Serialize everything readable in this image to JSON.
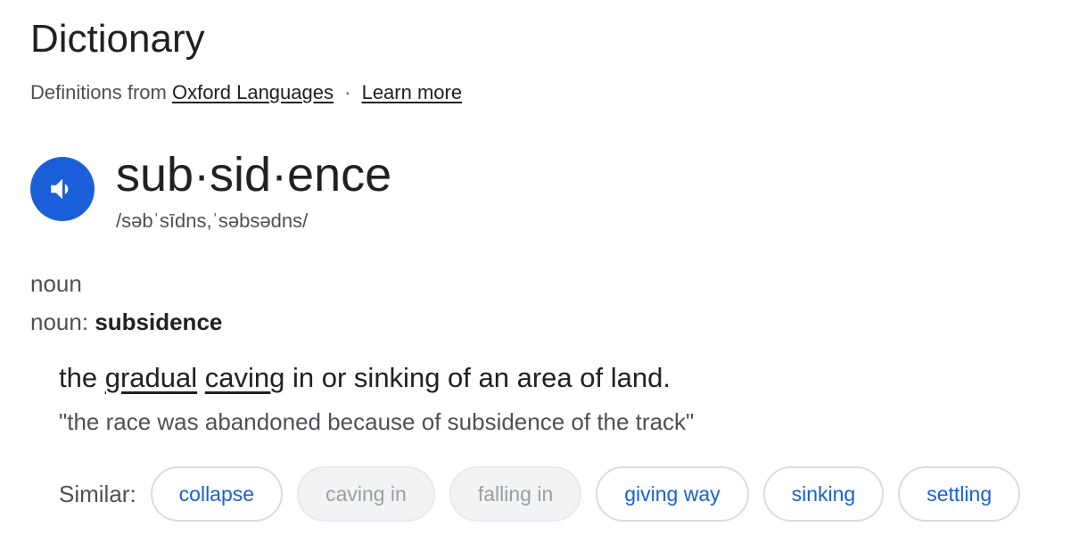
{
  "header": {
    "title": "Dictionary",
    "source_prefix": "Definitions from",
    "source_link": "Oxford Languages",
    "separator": "·",
    "learn_more": "Learn more"
  },
  "entry": {
    "audio_icon": "speaker-icon",
    "headword": "sub·sid·ence",
    "phonetic": "/səbˈsīdns,ˈsəbsədns/",
    "part_of_speech": "noun",
    "pos_prefix": "noun:",
    "pos_word": "subsidence"
  },
  "definition": {
    "word1": "the",
    "link1": "gradual",
    "link2": "caving",
    "rest": "in or sinking of an area of land.",
    "example": "\"the race was abandoned because of subsidence of the track\""
  },
  "similar": {
    "label": "Similar:",
    "chips": [
      {
        "label": "collapse",
        "enabled": true
      },
      {
        "label": "caving in",
        "enabled": false
      },
      {
        "label": "falling in",
        "enabled": false
      },
      {
        "label": "giving way",
        "enabled": true
      },
      {
        "label": "sinking",
        "enabled": true
      },
      {
        "label": "settling",
        "enabled": true
      }
    ]
  },
  "colors": {
    "accent_blue": "#1a5fd9",
    "text_primary": "#202124",
    "text_secondary": "#4d5156",
    "chip_disabled_bg": "#f1f3f4"
  }
}
